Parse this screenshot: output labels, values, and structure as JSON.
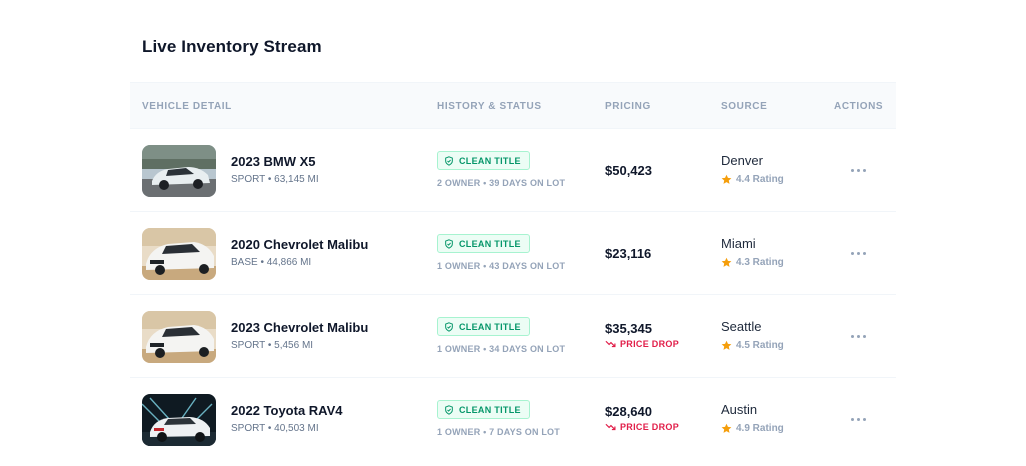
{
  "title": "Live Inventory Stream",
  "columns": {
    "vehicle": "VEHICLE DETAIL",
    "history": "HISTORY & STATUS",
    "pricing": "PRICING",
    "source": "SOURCE",
    "actions": "ACTIONS"
  },
  "colors": {
    "accent_green": "#059669",
    "price_drop": "#e11d48",
    "star": "#f59e0b"
  },
  "rows": [
    {
      "name": "2023 BMW X5",
      "sub": "SPORT • 63,145 MI",
      "badge": "CLEAN TITLE",
      "history": "2 OWNER • 39 DAYS ON LOT",
      "price": "$50,423",
      "price_drop": "",
      "city": "Denver",
      "rating": "4.4 Rating"
    },
    {
      "name": "2020 Chevrolet Malibu",
      "sub": "BASE • 44,866 MI",
      "badge": "CLEAN TITLE",
      "history": "1 OWNER • 43 DAYS ON LOT",
      "price": "$23,116",
      "price_drop": "",
      "city": "Miami",
      "rating": "4.3 Rating"
    },
    {
      "name": "2023 Chevrolet Malibu",
      "sub": "SPORT • 5,456 MI",
      "badge": "CLEAN TITLE",
      "history": "1 OWNER • 34 DAYS ON LOT",
      "price": "$35,345",
      "price_drop": "PRICE DROP",
      "city": "Seattle",
      "rating": "4.5 Rating"
    },
    {
      "name": "2022 Toyota RAV4",
      "sub": "SPORT • 40,503 MI",
      "badge": "CLEAN TITLE",
      "history": "1 OWNER • 7 DAYS ON LOT",
      "price": "$28,640",
      "price_drop": "PRICE DROP",
      "city": "Austin",
      "rating": "4.9 Rating"
    }
  ]
}
